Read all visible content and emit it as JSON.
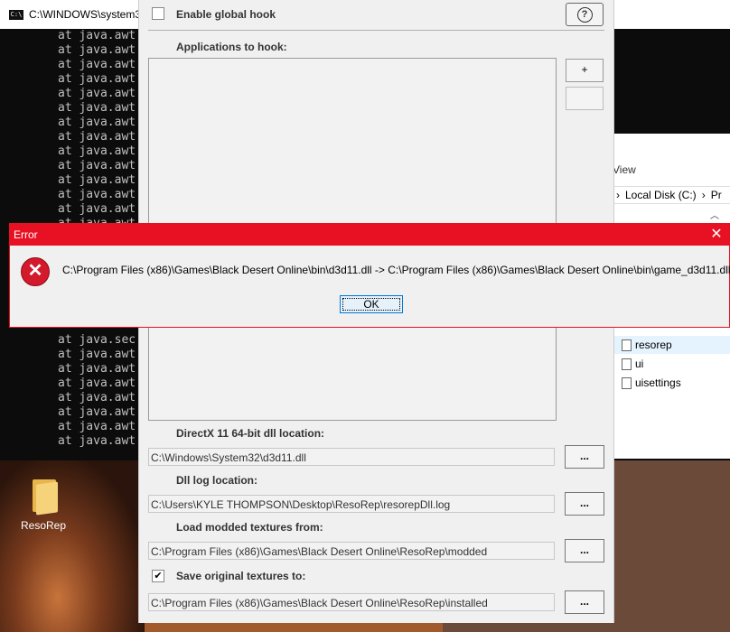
{
  "console": {
    "title": "C:\\WINDOWS\\system3",
    "icon_text": "C:\\",
    "lines": [
      "at java.awt",
      "at java.awt",
      "at java.awt",
      "at java.awt",
      "at java.awt",
      "at java.awt",
      "at java.awt",
      "at java.awt",
      "at java.awt",
      "at java.awt",
      "at java.awt",
      "at java.awt",
      "at java.awt",
      "at java.awt",
      "at java.awt"
    ],
    "lower_lines": [
      "at java.sec",
      "at java.awt",
      "at java.awt",
      "at java.awt",
      "at java.awt",
      "at java.awt",
      "at java.awt",
      "at java.awt"
    ]
  },
  "desktop": {
    "icon_label": "ResoRep"
  },
  "explorer": {
    "view_label": "View",
    "address": "Local Disk (C:)",
    "address_more": "Pr",
    "items": [
      "resorep",
      "ui",
      "uisettings"
    ]
  },
  "main_dialog": {
    "enable_global_hook": "Enable global hook",
    "help": "?",
    "applications_label": "Applications to hook:",
    "add_button": "+",
    "remove_button": "",
    "dx11_label": "DirectX 11 64-bit dll location:",
    "dx11_value": "C:\\Windows\\System32\\d3d11.dll",
    "dll_log_label": "Dll log location:",
    "dll_log_value": "C:\\Users\\KYLE THOMPSON\\Desktop\\ResoRep\\resorepDll.log",
    "load_modded_label": "Load modded textures from:",
    "load_modded_value": "C:\\Program Files (x86)\\Games\\Black Desert Online\\ResoRep\\modded",
    "save_original_label": "Save original textures to:",
    "save_original_checked": "✔",
    "save_original_value": "C:\\Program Files (x86)\\Games\\Black Desert Online\\ResoRep\\installed",
    "browse": "..."
  },
  "error_dialog": {
    "title": "Error",
    "close": "✕",
    "icon": "✕",
    "message": "C:\\Program Files (x86)\\Games\\Black Desert Online\\bin\\d3d11.dll -> C:\\Program Files (x86)\\Games\\Black Desert Online\\bin\\game_d3d11.dll",
    "ok": "OK"
  },
  "colors": {
    "error_red": "#e81123",
    "console_bg": "#0c0c0c",
    "dialog_bg": "#f0f0f0"
  }
}
